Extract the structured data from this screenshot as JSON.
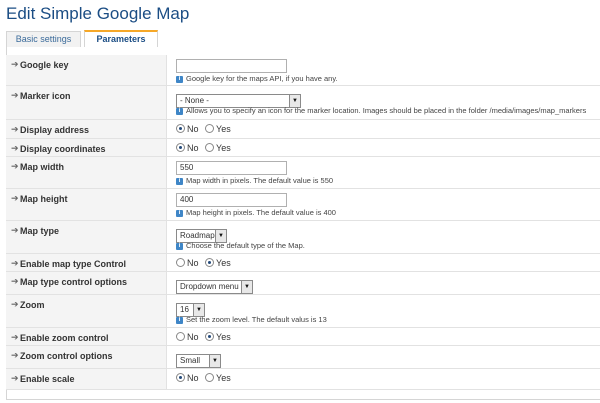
{
  "page": {
    "title": "Edit Simple Google Map"
  },
  "tabs": [
    {
      "label": "Basic settings",
      "active": false
    },
    {
      "label": "Parameters",
      "active": true
    }
  ],
  "params": {
    "google_key": {
      "label": "Google key",
      "value": "",
      "hint": "Google key for the maps API, if you have any."
    },
    "marker_icon": {
      "label": "Marker icon",
      "value": "- None -",
      "hint": "Allows you to specify an icon for the marker location. Images should be placed in the folder /media/images/map_markers"
    },
    "display_address": {
      "label": "Display address",
      "options": [
        "No",
        "Yes"
      ],
      "selected": "No"
    },
    "display_coordinates": {
      "label": "Display coordinates",
      "options": [
        "No",
        "Yes"
      ],
      "selected": "No"
    },
    "map_width": {
      "label": "Map width",
      "value": "550",
      "hint": "Map width in pixels. The default value is 550"
    },
    "map_height": {
      "label": "Map height",
      "value": "400",
      "hint": "Map height in pixels. The default value is 400"
    },
    "map_type": {
      "label": "Map type",
      "value": "Roadmap",
      "hint": "Choose the default type of the Map."
    },
    "enable_map_type_control": {
      "label": "Enable map type Control",
      "options": [
        "No",
        "Yes"
      ],
      "selected": "Yes"
    },
    "map_type_control_options": {
      "label": "Map type control options",
      "value": "Dropdown menu"
    },
    "zoom": {
      "label": "Zoom",
      "value": "16",
      "hint": "Set the zoom level. The default valus is 13"
    },
    "enable_zoom_control": {
      "label": "Enable zoom control",
      "options": [
        "No",
        "Yes"
      ],
      "selected": "Yes"
    },
    "zoom_control_options": {
      "label": "Zoom control options",
      "value": "Small"
    },
    "enable_scale": {
      "label": "Enable scale",
      "options": [
        "No",
        "Yes"
      ],
      "selected": "No"
    }
  },
  "icons": {
    "row_arrow": "arrow-right-icon",
    "info": "info-icon",
    "dropdown": "chevron-down-icon"
  },
  "colors": {
    "title": "#1b4d84",
    "active_tab_border": "#f6a828",
    "label_bg": "#f4f4f4",
    "info_icon": "#3f86c7"
  }
}
